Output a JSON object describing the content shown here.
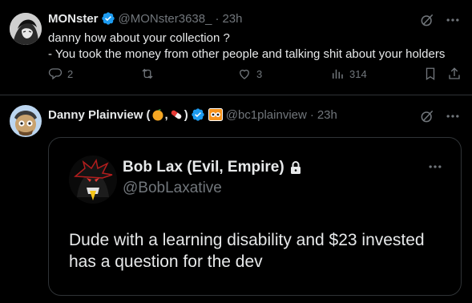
{
  "tweet1": {
    "display_name": "MONster",
    "handle": "@MONster3638_",
    "separator": "·",
    "time": "23h",
    "lines": [
      "danny how about your collection ?",
      "- You took the money from other people and talking shit about your holders"
    ],
    "replies": "2",
    "retweets": "",
    "likes": "3",
    "views": "314",
    "icons": [
      "grok-icon",
      "more-icon",
      "reply-icon",
      "retweet-icon",
      "like-icon",
      "views-icon",
      "bookmark-icon",
      "share-icon"
    ]
  },
  "tweet2": {
    "display_name": "Danny Plainview (",
    "name_emojis": [
      "orange-emoji",
      "pill-emoji"
    ],
    "name_comma": ",",
    "name_close": ")",
    "handle": "@bc1plainview",
    "separator": "·",
    "time": "23h",
    "affiliate_badge": "orange-mask-badge"
  },
  "quote": {
    "display_name": "Bob Lax (Evil, Empire)",
    "handle": "@BobLaxative",
    "text": "Dude with a learning disability and $23 invested has a question for the dev",
    "protected_icon": "lock-icon"
  },
  "colors": {
    "background": "#000000",
    "text": "#e7e9ea",
    "muted": "#71767b",
    "verified": "#1d9bf0",
    "border": "#2f3336"
  }
}
